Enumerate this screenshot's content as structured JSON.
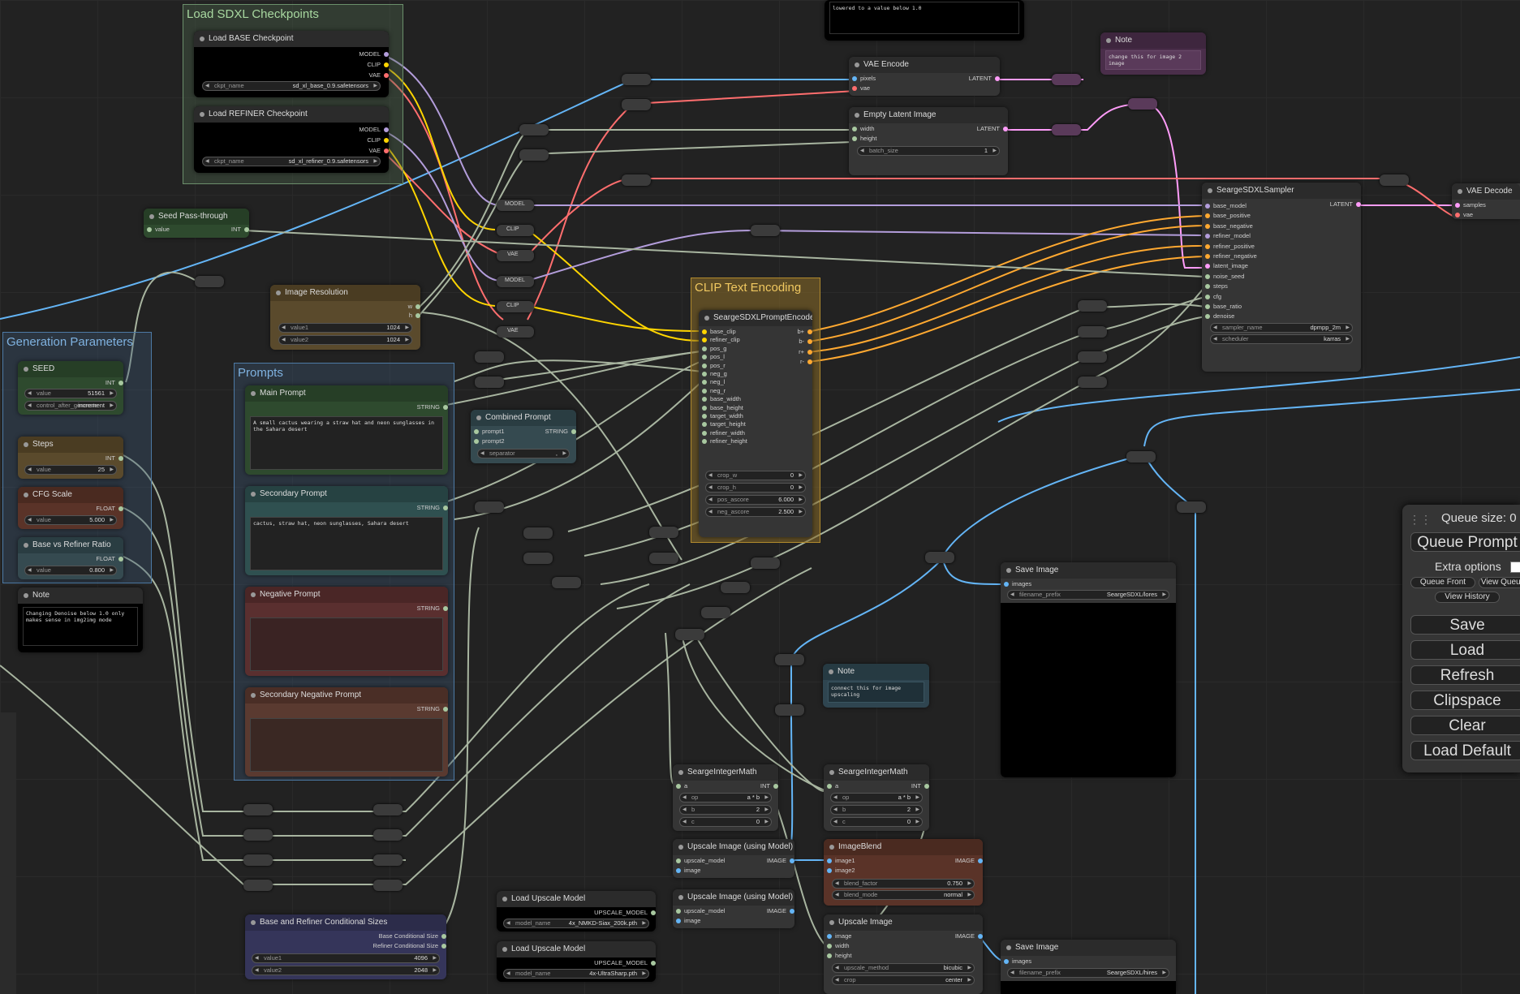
{
  "groups": {
    "checkpoints": "Load SDXL Checkpoints",
    "generation": "Generation Parameters",
    "prompts": "Prompts",
    "clip": "CLIP Text Encoding"
  },
  "nodes": {
    "base_ckpt": {
      "title": "Load BASE Checkpoint",
      "out_model": "MODEL",
      "out_clip": "CLIP",
      "out_vae": "VAE",
      "w_label": "ckpt_name",
      "w_value": "sd_xl_base_0.9.safetensors"
    },
    "refiner_ckpt": {
      "title": "Load REFINER Checkpoint",
      "out_model": "MODEL",
      "out_clip": "CLIP",
      "out_vae": "VAE",
      "w_label": "ckpt_name",
      "w_value": "sd_xl_refiner_0.9.safetensors"
    },
    "seed_pass": {
      "title": "Seed Pass-through",
      "in": "value",
      "out": "INT"
    },
    "image_res": {
      "title": "Image Resolution",
      "out1": "w",
      "out2": "h",
      "v1_label": "value1",
      "v1": "1024",
      "v2_label": "value2",
      "v2": "1024"
    },
    "seed": {
      "title": "SEED",
      "out": "INT",
      "w1_label": "value",
      "w1": "51561",
      "w2_label": "control_after_generate",
      "w2": "increment"
    },
    "steps": {
      "title": "Steps",
      "out": "INT",
      "w_label": "value",
      "w_value": "25"
    },
    "cfg": {
      "title": "CFG Scale",
      "out": "FLOAT",
      "w_label": "value",
      "w_value": "5.000"
    },
    "ratio": {
      "title": "Base vs Refiner Ratio",
      "out": "FLOAT",
      "w_label": "value",
      "w_value": "0.800"
    },
    "note_left": {
      "title": "Note",
      "text": "Changing Denoise below 1.0 only makes sense in img2img mode"
    },
    "main_prompt": {
      "title": "Main Prompt",
      "out": "STRING",
      "text": "A small cactus wearing a straw hat and neon sunglasses in the Sahara desert"
    },
    "secondary_prompt": {
      "title": "Secondary Prompt",
      "out": "STRING",
      "text": "cactus, straw hat, neon sunglasses, Sahara desert"
    },
    "negative_prompt": {
      "title": "Negative Prompt",
      "out": "STRING",
      "text": ""
    },
    "secondary_negative": {
      "title": "Secondary Negative Prompt",
      "out": "STRING",
      "text": ""
    },
    "combined": {
      "title": "Combined Prompt",
      "in1": "prompt1",
      "in2": "prompt2",
      "out": "STRING",
      "w_label": "separator",
      "w_value": ","
    },
    "vae_encode": {
      "title": "VAE Encode",
      "in1": "pixels",
      "in2": "vae",
      "out": "LATENT"
    },
    "empty_latent": {
      "title": "Empty Latent Image",
      "in1": "width",
      "in2": "height",
      "out": "LATENT",
      "w_label": "batch_size",
      "w_value": "1"
    },
    "note_top": {
      "title": "Note",
      "text": "change this for image 2 image"
    },
    "note_top_black": {
      "text": "lowered to a value below 1.0"
    },
    "sampler": {
      "title": "SeargeSDXLSampler",
      "out": "LATENT",
      "inputs": [
        "base_model",
        "base_positive",
        "base_negative",
        "refiner_model",
        "refiner_positive",
        "refiner_negative",
        "latent_image",
        "noise_seed",
        "steps",
        "cfg",
        "base_ratio",
        "denoise"
      ],
      "w1_label": "sampler_name",
      "w1": "dpmpp_2m",
      "w2_label": "scheduler",
      "w2": "karras"
    },
    "vae_decode": {
      "title": "VAE Decode",
      "in1": "samples",
      "in2": "vae"
    },
    "encoder": {
      "title": "SeargeSDXLPromptEncoder",
      "inputs": [
        "base_clip",
        "refiner_clip",
        "pos_g",
        "pos_l",
        "pos_r",
        "neg_g",
        "neg_l",
        "neg_r",
        "base_width",
        "base_height",
        "target_width",
        "target_height",
        "refiner_width",
        "refiner_height"
      ],
      "outs": [
        "b+",
        "b-",
        "r+",
        "r-"
      ],
      "widgets": [
        [
          "crop_w",
          "0"
        ],
        [
          "crop_h",
          "0"
        ],
        [
          "pos_ascore",
          "6.000"
        ],
        [
          "neg_ascore",
          "2.500"
        ]
      ]
    },
    "save_lores": {
      "title": "Save Image",
      "in": "images",
      "w_label": "filename_prefix",
      "w_value": "SeargeSDXL/lores"
    },
    "note_mid": {
      "title": "Note",
      "text": "connect this for image upscaling"
    },
    "math1": {
      "title": "SeargeIntegerMath",
      "in": "a",
      "out": "INT",
      "w": [
        [
          "op",
          "a * b"
        ],
        [
          "b",
          "2"
        ],
        [
          "c",
          "0"
        ]
      ]
    },
    "math2": {
      "title": "SeargeIntegerMath",
      "in": "a",
      "out": "INT",
      "w": [
        [
          "op",
          "a * b"
        ],
        [
          "b",
          "2"
        ],
        [
          "c",
          "0"
        ]
      ]
    },
    "upscale1": {
      "title": "Upscale Image (using Model)",
      "in1": "upscale_model",
      "in2": "image",
      "out": "IMAGE"
    },
    "upscale2": {
      "title": "Upscale Image (using Model)",
      "in1": "upscale_model",
      "in2": "image",
      "out": "IMAGE"
    },
    "blend": {
      "title": "ImageBlend",
      "in1": "image1",
      "in2": "image2",
      "out": "IMAGE",
      "w1_label": "blend_factor",
      "w1": "0.750",
      "w2_label": "blend_mode",
      "w2": "normal"
    },
    "upscale_img": {
      "title": "Upscale Image",
      "in1": "image",
      "in2": "width",
      "in3": "height",
      "out": "IMAGE",
      "w1_label": "upscale_method",
      "w1": "bicubic",
      "w2_label": "crop",
      "w2": "center"
    },
    "save_hires": {
      "title": "Save Image",
      "in": "images",
      "w_label": "filename_prefix",
      "w_value": "SeargeSDXL/hires"
    },
    "load_up1": {
      "title": "Load Upscale Model",
      "out": "UPSCALE_MODEL",
      "w_label": "model_name",
      "w_value": "4x_NMKD-Siax_200k.pth"
    },
    "load_up2": {
      "title": "Load Upscale Model",
      "out": "UPSCALE_MODEL",
      "w_label": "model_name",
      "w_value": "4x-UltraSharp.pth"
    },
    "cond_sizes": {
      "title": "Base and Refiner Conditional Sizes",
      "out1": "Base Conditional Size",
      "out2": "Refiner Conditional Size",
      "v1_label": "value1",
      "v1": "4096",
      "v2_label": "value2",
      "v2": "2048"
    }
  },
  "reroute_labels": {
    "model": "MODEL",
    "clip": "CLIP",
    "vae": "VAE"
  },
  "queue_panel": {
    "queue_size": "Queue size: 0",
    "queue_prompt": "Queue Prompt",
    "extra_options": "Extra options",
    "queue_front": "Queue Front",
    "view_queue": "View Queue",
    "view_history": "View History",
    "save": "Save",
    "load": "Load",
    "refresh": "Refresh",
    "clipspace": "Clipspace",
    "clear": "Clear",
    "load_default": "Load Default"
  },
  "colors": {
    "model": "#b39ddb",
    "clip": "#ffd500",
    "vae": "#ff6e6e",
    "latent": "#ff9cf9",
    "image": "#64b5f6",
    "int": "#a8c8a0",
    "conditioning": "#ffa931"
  }
}
